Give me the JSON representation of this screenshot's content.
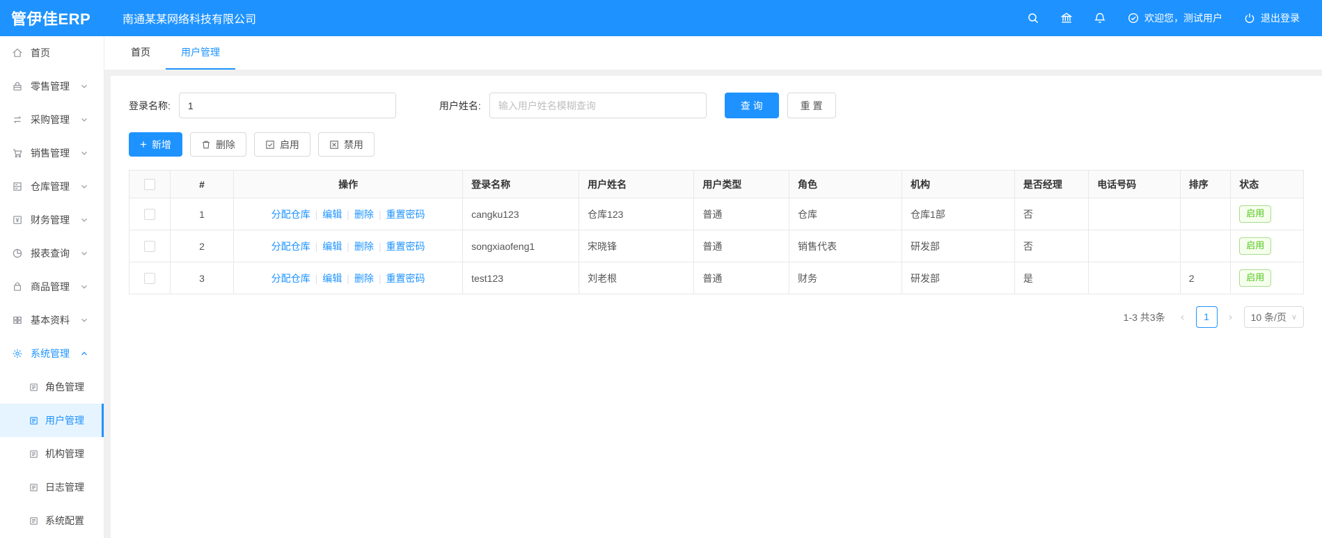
{
  "topbar": {
    "logo": "管伊佳ERP",
    "company": "南通某某网络科技有限公司",
    "welcome": "欢迎您，测试用户",
    "logout": "退出登录"
  },
  "sidebar": {
    "items": [
      {
        "label": "首页"
      },
      {
        "label": "零售管理"
      },
      {
        "label": "采购管理"
      },
      {
        "label": "销售管理"
      },
      {
        "label": "仓库管理"
      },
      {
        "label": "财务管理"
      },
      {
        "label": "报表查询"
      },
      {
        "label": "商品管理"
      },
      {
        "label": "基本资料"
      },
      {
        "label": "系统管理"
      }
    ],
    "subitems": [
      "角色管理",
      "用户管理",
      "机构管理",
      "日志管理",
      "系统配置"
    ],
    "active_item": "用户管理"
  },
  "tabs": [
    {
      "label": "首页"
    },
    {
      "label": "用户管理"
    }
  ],
  "filters": {
    "login_name_label": "登录名称:",
    "login_name_value": "1",
    "user_name_label": "用户姓名:",
    "user_name_placeholder": "输入用户姓名模糊查询",
    "search_label": "查 询",
    "reset_label": "重 置"
  },
  "toolbar": {
    "add_label": "新增",
    "delete_label": "删除",
    "enable_label": "启用",
    "disable_label": "禁用"
  },
  "table": {
    "headers": [
      "#",
      "操作",
      "登录名称",
      "用户姓名",
      "用户类型",
      "角色",
      "机构",
      "是否经理",
      "电话号码",
      "排序",
      "状态"
    ],
    "action_links": [
      "分配仓库",
      "编辑",
      "删除",
      "重置密码"
    ],
    "rows": [
      {
        "index": "1",
        "login": "cangku123",
        "name": "仓库123",
        "type": "普通",
        "role": "仓库",
        "org": "仓库1部",
        "manager": "否",
        "phone": "",
        "sort": "",
        "status": "启用"
      },
      {
        "index": "2",
        "login": "songxiaofeng1",
        "name": "宋晓锋",
        "type": "普通",
        "role": "销售代表",
        "org": "研发部",
        "manager": "否",
        "phone": "",
        "sort": "",
        "status": "启用"
      },
      {
        "index": "3",
        "login": "test123",
        "name": "刘老根",
        "type": "普通",
        "role": "财务",
        "org": "研发部",
        "manager": "是",
        "phone": "",
        "sort": "2",
        "status": "启用"
      }
    ]
  },
  "pagination": {
    "total_text": "1-3 共3条",
    "prev_icon": "‹",
    "next_icon": "›",
    "current_page": "1",
    "page_size": "10 条/页",
    "caret_icon": "∨"
  },
  "icons": {
    "topbar": [
      "search-icon",
      "bank-icon",
      "bell-icon",
      "welcome-check-icon",
      "logout-power-icon"
    ],
    "sidebar": [
      "home-icon",
      "retail-icon",
      "purchase-icon",
      "sales-cart-icon",
      "warehouse-icon",
      "finance-icon",
      "report-pie-icon",
      "goods-bag-icon",
      "basic-grid-icon",
      "gear-icon",
      "doc-icon"
    ]
  },
  "colors": {
    "primary": "#1e93ff",
    "active_bg": "#e6f4ff",
    "success": "#52c41a",
    "success_bg": "#f6ffed",
    "border": "#e8e8e8"
  }
}
